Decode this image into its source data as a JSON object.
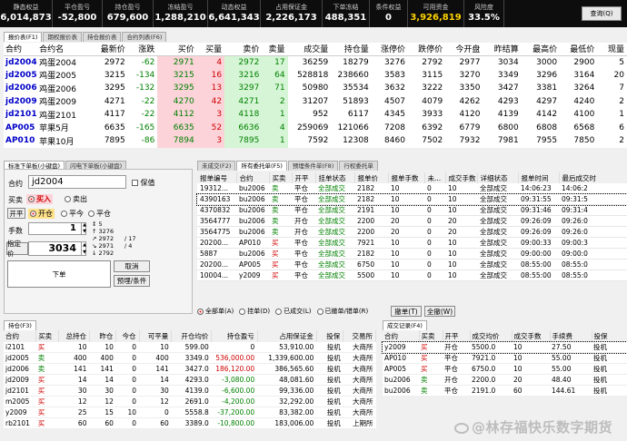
{
  "topbar": {
    "stats": [
      {
        "label": "静态权益",
        "value": "6,014,873"
      },
      {
        "label": "平仓盈亏",
        "value": "-52,800"
      },
      {
        "label": "持仓盈亏",
        "value": "679,600"
      },
      {
        "label": "冻结盈亏",
        "value": "1,288,210"
      },
      {
        "label": "动态权益",
        "value": "6,641,343"
      },
      {
        "label": "占用保证金",
        "value": "2,226,173"
      },
      {
        "label": "下单冻结",
        "value": "488,351"
      },
      {
        "label": "条件权益",
        "value": "0"
      },
      {
        "label": "可用资金",
        "value": "3,926,819"
      },
      {
        "label": "风险度",
        "value": "33.5%"
      }
    ],
    "query_button": "查询(Q)"
  },
  "quote_tabs": [
    "报价表(F1)",
    "期权报价表",
    "持仓报价表",
    "合约列表(F6)"
  ],
  "quote": {
    "headers": [
      "合约",
      "合约名",
      "最新价",
      "涨跌",
      "买价",
      "买量",
      "卖价",
      "卖量",
      "成交量",
      "持仓量",
      "涨停价",
      "跌停价",
      "今开盘",
      "昨结算",
      "最高价",
      "最低价",
      "现量"
    ],
    "rows": [
      [
        "jd2004",
        "鸡蛋2004",
        "2972",
        "-62",
        "2971",
        "4",
        "2972",
        "17",
        "36259",
        "18279",
        "3276",
        "2792",
        "2977",
        "3034",
        "3000",
        "2900",
        "5"
      ],
      [
        "jd2005",
        "鸡蛋2005",
        "3215",
        "-134",
        "3215",
        "16",
        "3216",
        "64",
        "528818",
        "238660",
        "3583",
        "3115",
        "3270",
        "3349",
        "3296",
        "3164",
        "20"
      ],
      [
        "jd2006",
        "鸡蛋2006",
        "3295",
        "-132",
        "3295",
        "13",
        "3297",
        "71",
        "50980",
        "35534",
        "3632",
        "3222",
        "3350",
        "3427",
        "3381",
        "3264",
        "7"
      ],
      [
        "jd2009",
        "鸡蛋2009",
        "4271",
        "-22",
        "4270",
        "42",
        "4271",
        "2",
        "31207",
        "51893",
        "4507",
        "4079",
        "4262",
        "4293",
        "4297",
        "4240",
        "2"
      ],
      [
        "jd2101",
        "鸡蛋2101",
        "4117",
        "-22",
        "4112",
        "3",
        "4118",
        "1",
        "952",
        "6117",
        "4345",
        "3933",
        "4120",
        "4139",
        "4142",
        "4100",
        "1"
      ],
      [
        "AP005",
        "苹果5月",
        "6635",
        "-165",
        "6635",
        "52",
        "6636",
        "4",
        "259069",
        "121066",
        "7208",
        "6392",
        "6779",
        "6800",
        "6808",
        "6568",
        "6"
      ],
      [
        "AP010",
        "苹果10月",
        "7895",
        "-86",
        "7894",
        "3",
        "7895",
        "1",
        "7592",
        "12308",
        "8460",
        "7502",
        "7932",
        "7981",
        "7955",
        "7850",
        "2"
      ]
    ]
  },
  "order_tabs": [
    "标准下单板(小键盘)",
    "闪电下单板(小键盘)"
  ],
  "order": {
    "contract_label": "合约",
    "contract_value": "jd2004",
    "guarantee_label": "保值",
    "side_label": "买卖",
    "buy": "买入",
    "sell": "卖出",
    "oc_label": "开平",
    "open": "开仓",
    "close": "平今",
    "close2": "平仓",
    "qty_label": "手数",
    "qty_value": "1",
    "price_label": "指定价",
    "price_value": "3034",
    "depth": [
      "5",
      "3276",
      "2972",
      "2971",
      "2792"
    ],
    "depth_right": [
      "17",
      "4"
    ],
    "submit": "下单",
    "cancel": "取消",
    "preset": "预埋/条件"
  },
  "entrust_tabs": [
    "未成交(F2)",
    "所有委托单(F5)",
    "预埋条件单(F8)",
    "行权委托单"
  ],
  "entrust": {
    "headers": [
      "报单编号",
      "合约",
      "买卖",
      "开平",
      "挂单状态",
      "报单价",
      "报单手数",
      "未...",
      "成交手数",
      "详细状态",
      "报单时间",
      "最后成交时"
    ],
    "rows": [
      [
        "19312...",
        "bu2006",
        "卖",
        "平仓",
        "全部成交",
        "2182",
        "10",
        "0",
        "10",
        "全部成交",
        "14:06:23",
        "14:06:2"
      ],
      [
        "4390163",
        "bu2006",
        "卖",
        "平仓",
        "全部成交",
        "2182",
        "10",
        "0",
        "10",
        "全部成交",
        "09:31:55",
        "09:31:5"
      ],
      [
        "4370832",
        "bu2006",
        "卖",
        "平仓",
        "全部成交",
        "2191",
        "10",
        "0",
        "10",
        "全部成交",
        "09:31:46",
        "09:31:4"
      ],
      [
        "3564777",
        "bu2006",
        "卖",
        "开仓",
        "全部成交",
        "2200",
        "20",
        "0",
        "20",
        "全部成交",
        "09:26:09",
        "09:26:0"
      ],
      [
        "3564775",
        "bu2006",
        "卖",
        "开仓",
        "全部成交",
        "2200",
        "20",
        "0",
        "20",
        "全部成交",
        "09:26:09",
        "09:26:0"
      ],
      [
        "20200...",
        "AP010",
        "买",
        "平仓",
        "全部成交",
        "7921",
        "10",
        "0",
        "10",
        "全部成交",
        "09:00:33",
        "09:00:3"
      ],
      [
        "5887",
        "bu2006",
        "买",
        "平仓",
        "全部成交",
        "2182",
        "10",
        "0",
        "10",
        "全部成交",
        "09:00:00",
        "09:00:0"
      ],
      [
        "20200...",
        "AP005",
        "买",
        "平仓",
        "全部成交",
        "6750",
        "10",
        "0",
        "10",
        "全部成交",
        "08:55:00",
        "08:55:0"
      ],
      [
        "10004...",
        "y2009",
        "买",
        "平仓",
        "全部成交",
        "5500",
        "10",
        "0",
        "10",
        "全部成交",
        "08:55:00",
        "08:55:0"
      ]
    ],
    "radios": [
      "全部单(A)",
      "挂单(D)",
      "已成交(L)",
      "已撤单/错单(R)"
    ],
    "cancel_btn": "撤单(T)",
    "cancel_all_btn": "全撤(W)"
  },
  "pos_tab": "持仓(F3)",
  "positions": {
    "headers": [
      "合约",
      "买卖",
      "总持仓",
      "昨仓",
      "今仓",
      "可平量",
      "开仓均价",
      "持仓盈亏",
      "占用保证金",
      "投保",
      "交易所"
    ],
    "rows": [
      [
        "i2101",
        "买",
        "10",
        "10",
        "0",
        "10",
        "599.00",
        "0",
        "53,910.00",
        "投机",
        "大商所"
      ],
      [
        "jd2005",
        "卖",
        "400",
        "400",
        "0",
        "400",
        "3349.0",
        "536,000.00",
        "1,339,600.00",
        "投机",
        "大商所"
      ],
      [
        "jd2006",
        "卖",
        "141",
        "141",
        "0",
        "141",
        "3427.0",
        "186,120.00",
        "386,565.60",
        "投机",
        "大商所"
      ],
      [
        "jd2009",
        "买",
        "14",
        "14",
        "0",
        "14",
        "4293.0",
        "-3,080.00",
        "48,081.60",
        "投机",
        "大商所"
      ],
      [
        "jd2101",
        "买",
        "30",
        "30",
        "0",
        "30",
        "4139.0",
        "-6,600.00",
        "99,336.00",
        "投机",
        "大商所"
      ],
      [
        "m2005",
        "买",
        "12",
        "12",
        "0",
        "12",
        "2691.0",
        "-4,200.00",
        "32,292.00",
        "投机",
        "大商所"
      ],
      [
        "y2009",
        "买",
        "25",
        "15",
        "10",
        "0",
        "5558.8",
        "-37,200.00",
        "83,382.00",
        "投机",
        "大商所"
      ],
      [
        "rb2101",
        "买",
        "60",
        "60",
        "0",
        "60",
        "3389.0",
        "-10,800.00",
        "183,006.00",
        "投机",
        "上期所"
      ]
    ]
  },
  "deal_tab": "成交记录(F4)",
  "deals": {
    "headers": [
      "合约",
      "买卖",
      "开平",
      "成交均价",
      "成交手数",
      "手续费",
      "投保"
    ],
    "rows": [
      [
        "y2009",
        "买",
        "开仓",
        "5500.0",
        "10",
        "27.50",
        "投机"
      ],
      [
        "AP010",
        "买",
        "平仓",
        "7921.0",
        "10",
        "55.00",
        "投机"
      ],
      [
        "AP005",
        "买",
        "平仓",
        "6750.0",
        "10",
        "55.00",
        "投机"
      ],
      [
        "bu2006",
        "卖",
        "开仓",
        "2200.0",
        "20",
        "48.40",
        "投机"
      ],
      [
        "bu2006",
        "卖",
        "平仓",
        "2191.0",
        "60",
        "144.61",
        "投机"
      ]
    ]
  },
  "watermark": "@林存福快乐数字期货",
  "colors": {
    "topbar": "#0d0d0d",
    "yellow": "#ffd400",
    "bid_bg": "#fbd3d9",
    "ask_bg": "#d6f5d6",
    "red": "#d00000",
    "green": "#008000",
    "code": "#0000c8"
  }
}
